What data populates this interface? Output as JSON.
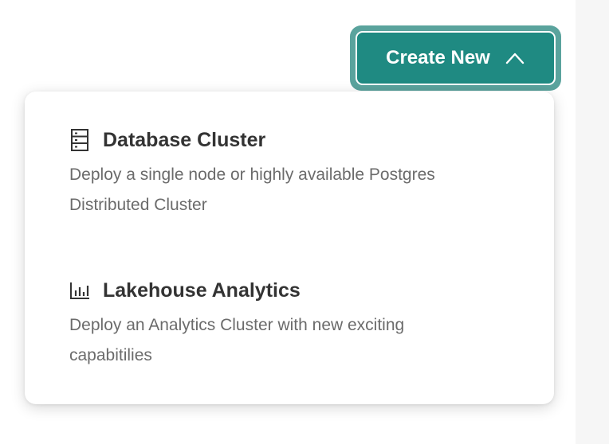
{
  "create_button": {
    "label": "Create New",
    "icon": "chevron-up-icon",
    "color": "#1f8a82",
    "outline_color": "#5aa39d"
  },
  "menu": {
    "items": [
      {
        "icon": "server-icon",
        "title": "Database Cluster",
        "description": "Deploy a single node or highly available Postgres Distributed Cluster"
      },
      {
        "icon": "bar-chart-icon",
        "title": "Lakehouse Analytics",
        "description": "Deploy an Analytics Cluster with new exciting capabitilies"
      }
    ]
  }
}
